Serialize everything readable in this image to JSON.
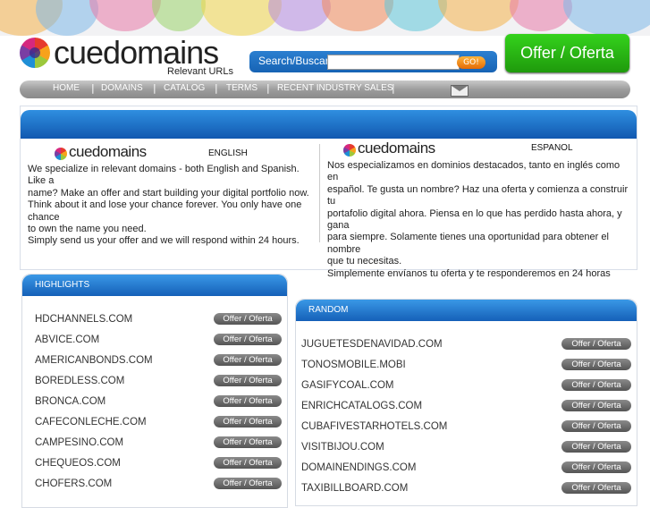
{
  "header": {
    "brand": "cuedomains",
    "tagline": "Relevant URLs",
    "search_label": "Search/Buscar",
    "search_value": "",
    "go_label": "GO!",
    "offer_label": "Offer / Oferta"
  },
  "nav": {
    "items": [
      "HOME",
      "DOMAINS",
      "CATALOG",
      "TERMS",
      "RECENT INDUSTRY SALES"
    ],
    "sep": "|",
    "mail_icon": "envelope-icon"
  },
  "intro": {
    "english": {
      "lang": "ENGLISH",
      "brand": "cuedomains",
      "lines": [
        "We specialize in relevant domains - both English and Spanish. Like a",
        "name? Make an offer and start building your digital portfolio now.",
        "Think about it and lose your chance forever. You only have one chance",
        "to own the name you need.",
        "Simply send us your offer and we will respond within 24 hours."
      ]
    },
    "spanish": {
      "lang": "ESPANOL",
      "brand": "cuedomains",
      "lines": [
        "Nos especializamos en dominios destacados, tanto en inglés como en",
        "español. Te gusta un nombre? Haz una oferta y comienza a construir tu",
        "portafolio digital ahora. Piensa en lo que has perdido hasta ahora, y gana",
        "para siempre. Solamente tienes una oportunidad para obtener el nombre",
        "que tu necesitas.",
        "Simplemente envíanos tu oferta y te responderemos en 24 horas"
      ]
    }
  },
  "highlights": {
    "title": "HIGHLIGHTS",
    "button_label": "Offer / Oferta",
    "domains": [
      "HDCHANNELS.COM",
      "ABVICE.COM",
      "AMERICANBONDS.COM",
      "BOREDLESS.COM",
      "BRONCA.COM",
      "CAFECONLECHE.COM",
      "CAMPESINO.COM",
      "CHEQUEOS.COM",
      "CHOFERS.COM"
    ]
  },
  "random": {
    "title": "RANDOM",
    "button_label": "Offer / Oferta",
    "domains": [
      "JUGUETESDENAVIDAD.COM",
      "TONOSMOBILE.MOBI",
      "GASIFYCOAL.COM",
      "ENRICHCATALOGS.COM",
      "CUBAFIVESTARHOTELS.COM",
      "VISITBIJOU.COM",
      "DOMAINENDINGS.COM",
      "TAXIBILLBOARD.COM"
    ]
  },
  "colors": {
    "accent_blue": "#1763b4",
    "offer_green": "#26b514",
    "go_orange": "#f08a1e",
    "nav_gray": "#a0a0a0"
  }
}
